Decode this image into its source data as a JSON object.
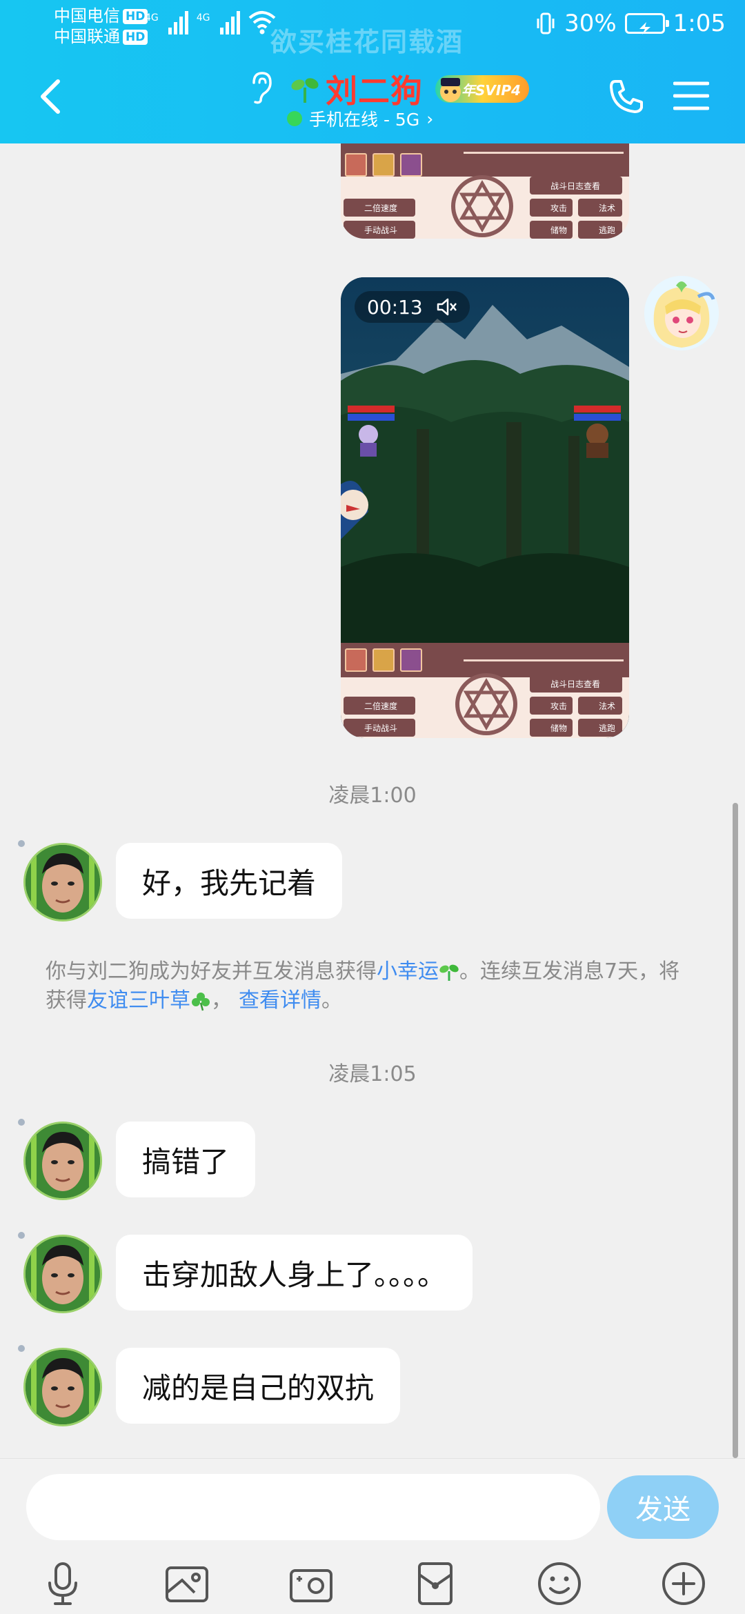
{
  "status_bar": {
    "carrier1": "中国电信",
    "carrier2": "中国联通",
    "hd": "HD",
    "net1": "4G",
    "net2": "4G",
    "watermark": "欲买桂花同载酒",
    "battery": "30%",
    "time": "1:05"
  },
  "header": {
    "contact_name": "刘二狗",
    "vip_label": "年SVIP4",
    "online_status": "手机在线 - 5G",
    "online_chevron": "›",
    "icons": [
      "back-icon",
      "ear-icon",
      "sprout-icon",
      "phone-icon",
      "menu-icon"
    ]
  },
  "game_ui": {
    "btn_speed": "二倍速度",
    "btn_manual": "手动战斗",
    "btn_log": "战斗日志查看",
    "btn_attack": "攻击",
    "btn_spell": "法术",
    "btn_item": "储物",
    "btn_escape": "逃跑"
  },
  "video": {
    "duration": "00:13"
  },
  "messages": {
    "time1": "凌晨1:00",
    "msg1": "好，我先记着",
    "system_prefix": "你与刘二狗成为好友并互发消息获得",
    "system_link1": "小幸运",
    "system_mid": "。连续互发消息7天，将获得",
    "system_link2": "友谊三叶草",
    "system_sep": "，",
    "system_link3": "查看详情",
    "system_end": "。",
    "time2": "凌晨1:05",
    "msg2": "搞错了",
    "msg3": "击穿加敌人身上了。。。。",
    "msg4": "减的是自己的双抗"
  },
  "composer": {
    "input_value": "",
    "send_label": "发送",
    "tools": [
      "microphone-icon",
      "image-icon",
      "camera-icon",
      "red-packet-icon",
      "emoji-icon",
      "plus-icon"
    ]
  },
  "colors": {
    "header": "#19b5f5",
    "name": "#ff3b30",
    "link": "#3f8cf0",
    "send": "#8fd0f6"
  }
}
